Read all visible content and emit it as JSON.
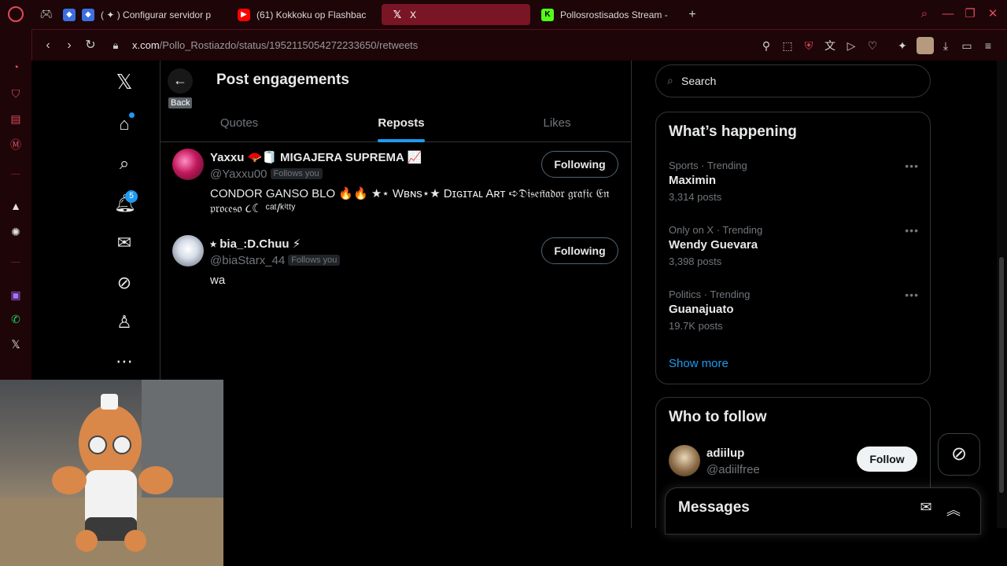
{
  "browser": {
    "tabs": [
      {
        "title": "( ✦ ) Configurar servidor p",
        "favicon": "roblox-icon"
      },
      {
        "title": "(61) Kokkoku op Flashbac",
        "favicon": "youtube-icon"
      },
      {
        "title": "X",
        "favicon": "x-icon",
        "active": true
      },
      {
        "title": "Pollosrostisados Stream -",
        "favicon": "kick-icon"
      }
    ],
    "new_tab": "+",
    "url_host": "x.com",
    "url_path": "/Pollo_Rostiazdo/status/1952115054272233650/retweets",
    "accent": "#e04a5c"
  },
  "xnav": {
    "notifications_count": "5"
  },
  "main": {
    "back_tooltip": "Back",
    "title": "Post engagements",
    "tabs": [
      "Quotes",
      "Reposts",
      "Likes"
    ],
    "selected_tab": "Reposts",
    "users": [
      {
        "name": "Yaxxu 🪭🧻 MIGAJERA SUPREMA 📈",
        "handle": "@Yaxxu00",
        "follows_you": "Follows you",
        "bio": "CONDOR GANSO BLO 🔥🔥 ★⋆ Wʙɴs⋆★ Dɪɢɪᴛᴀʟ Aʀᴛ ➪𝔇𝔦𝔰𝔢𝔫̃𝔞𝔡𝔬𝔯 𝔤𝔯𝔞𝔣𝔦𝔠 𝔈𝔫 𝔭𝔯𝔬𝔠𝔢𝔰𝔬 ૮☾ ᶜᵃᵗ/ᵏⁱᵗᵗʸ",
        "button": "Following"
      },
      {
        "name": "⭑ bia_:D.Chuu ⚡",
        "handle": "@biaStarx_44",
        "follows_you": "Follows you",
        "bio": "wa",
        "button": "Following"
      }
    ]
  },
  "right": {
    "search_placeholder": "Search",
    "happening_title": "What’s happening",
    "trends": [
      {
        "context": "Sports · Trending",
        "name": "Maximin",
        "count": "3,314 posts"
      },
      {
        "context": "Only on X · Trending",
        "name": "Wendy Guevara",
        "count": "3,398 posts"
      },
      {
        "context": "Politics · Trending",
        "name": "Guanajuato",
        "count": "19.7K posts"
      }
    ],
    "show_more": "Show more",
    "who_to_follow_title": "Who to follow",
    "suggestion": {
      "name": "adiilup",
      "handle": "@adiilfree",
      "button": "Follow"
    },
    "messages_title": "Messages"
  },
  "colors": {
    "x_blue": "#1d9bf0",
    "border": "#2f3336",
    "muted": "#71767b"
  }
}
